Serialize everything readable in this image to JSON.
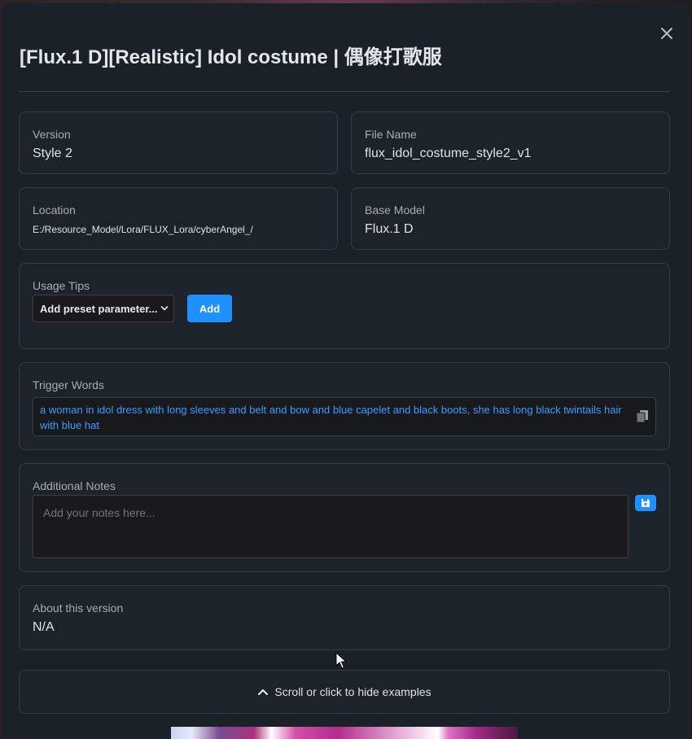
{
  "modal": {
    "title": "[Flux.1 D][Realistic] Idol costume | 偶像打歌服"
  },
  "fields": {
    "version": {
      "label": "Version",
      "value": "Style 2"
    },
    "file_name": {
      "label": "File Name",
      "value": "flux_idol_costume_style2_v1"
    },
    "location": {
      "label": "Location",
      "value": "E:/Resource_Model/Lora/FLUX_Lora/cyberAngel_/"
    },
    "base_model": {
      "label": "Base Model",
      "value": "Flux.1 D"
    }
  },
  "usage_tips": {
    "label": "Usage Tips",
    "select_value": "Add preset parameter...",
    "add_label": "Add"
  },
  "trigger_words": {
    "label": "Trigger Words",
    "text": "a woman in idol dress with long sleeves and belt and bow and blue capelet and black boots, she has long black twintails hair with blue hat"
  },
  "notes": {
    "label": "Additional Notes",
    "placeholder": "Add your notes here..."
  },
  "about": {
    "label": "About this version",
    "value": "N/A"
  },
  "examples_toggle": {
    "label": "Scroll or click to hide examples"
  },
  "colors": {
    "accent": "#1e90ff",
    "trigger_text": "#3b9bff",
    "modal_bg": "#1b2129"
  },
  "icons": [
    "close-icon",
    "chevron-down-icon",
    "copy-icon",
    "save-icon",
    "chevron-up-icon",
    "mouse-cursor-icon"
  ]
}
